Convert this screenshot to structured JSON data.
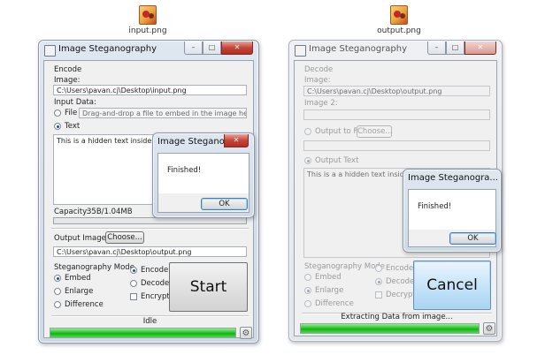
{
  "desktop": {
    "left_icon_label": "input.png",
    "right_icon_label": "output.png"
  },
  "left_window": {
    "title": "Image Steganography",
    "section": "Encode",
    "image_label": "Image:",
    "image_path": "C:\\Users\\pavan.cj\\Desktop\\input.png",
    "input_data_label": "Input Data:",
    "file_radio": "File",
    "file_placeholder": "Drag-and-drop a file to embed in the image here",
    "text_radio": "Text",
    "text_content": "This is a hidden text inside a Image",
    "capacity_label": "Capacity:",
    "capacity_value": "35B/1.04MB",
    "capacity_fraction": 0.0,
    "output_image_label": "Output Image:",
    "choose_button": "Choose...",
    "output_path": "C:\\Users\\pavan.cj\\Desktop\\output.png",
    "mode_label": "Steganography Mode",
    "mode_embed": "Embed",
    "mode_enlarge": "Enlarge",
    "mode_difference": "Difference",
    "encode": "Encode",
    "decode": "Decode",
    "encrypt": "Encrypt",
    "start_button": "Start",
    "status": "Idle",
    "progress": 1.0,
    "dialog": {
      "title": "Image Steganogra...",
      "message": "Finished!",
      "ok": "OK"
    }
  },
  "right_window": {
    "title": "Image Steganography",
    "section": "Decode",
    "image_label": "Image:",
    "image_path": "C:\\Users\\pavan.cj\\Desktop\\output.png",
    "image2_label": "Image 2:",
    "output_to_file_radio": "Output to File",
    "choose_button": "Choose...",
    "output_text_radio": "Output Text",
    "text_content": "This is a a hidden text inside a Image",
    "mode_label": "Steganography Mode",
    "mode_embed": "Embed",
    "mode_enlarge": "Enlarge",
    "mode_difference": "Difference",
    "encode": "Encode",
    "decode": "Decode",
    "decrypt": "Decrypt",
    "cancel_button": "Cancel",
    "status": "Extracting Data from image...",
    "progress": 1.0,
    "dialog": {
      "title": "Image Steganogra...",
      "message": "Finished!",
      "ok": "OK"
    }
  }
}
